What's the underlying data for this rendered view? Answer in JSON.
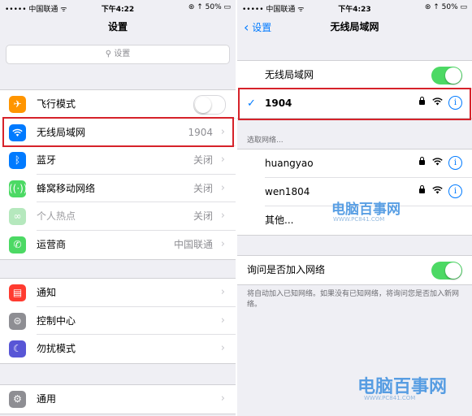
{
  "left": {
    "status": {
      "carrier": "••••• 中国联通 ᯤ",
      "time": "下午4:22",
      "battery": "⊛ ↑ 50% ▭"
    },
    "title": "设置",
    "search_placeholder": "设置",
    "group1": [
      {
        "icon": "airplane-icon",
        "color": "#ff9500",
        "label": "飞行模式",
        "toggle": "off"
      },
      {
        "icon": "wifi-icon",
        "color": "#007aff",
        "label": "无线局域网",
        "value": "1904"
      },
      {
        "icon": "bluetooth-icon",
        "color": "#007aff",
        "label": "蓝牙",
        "value": "关闭"
      },
      {
        "icon": "cellular-icon",
        "color": "#4cd964",
        "label": "蜂窝移动网络",
        "value": "关闭"
      },
      {
        "icon": "hotspot-icon",
        "color": "#4cd964",
        "label": "个人热点",
        "value": "关闭",
        "disabled": true
      },
      {
        "icon": "phone-icon",
        "color": "#4cd964",
        "label": "运营商",
        "value": "中国联通"
      }
    ],
    "group2": [
      {
        "icon": "notifications-icon",
        "color": "#ff3b30",
        "label": "通知"
      },
      {
        "icon": "control-center-icon",
        "color": "#8e8e93",
        "label": "控制中心"
      },
      {
        "icon": "moon-icon",
        "color": "#5856d6",
        "label": "勿扰模式"
      }
    ],
    "group3": [
      {
        "icon": "gear-icon",
        "color": "#8e8e93",
        "label": "通用"
      }
    ]
  },
  "right": {
    "status": {
      "carrier": "••••• 中国联通 ᯤ",
      "time": "下午4:23",
      "battery": "⊛ ↑ 50% ▭"
    },
    "back_label": "设置",
    "title": "无线局域网",
    "wifi_label": "无线局域网",
    "wifi_toggle": "on",
    "connected": "1904",
    "choose_header": "选取网络...",
    "networks": [
      {
        "name": "huangyao",
        "locked": true
      },
      {
        "name": "wen1804",
        "locked": true
      },
      {
        "name": "其他...",
        "locked": false
      }
    ],
    "ask_label": "询问是否加入网络",
    "ask_toggle": "on",
    "ask_caption": "将自动加入已知网络。如果没有已知网络，将询问您是否加入新网络。"
  },
  "watermark": {
    "text": "电脑百事网",
    "sub": "WWW.PC841.COM"
  }
}
